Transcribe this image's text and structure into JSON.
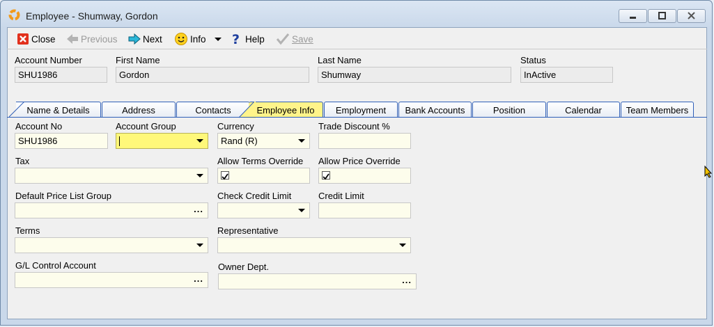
{
  "window": {
    "title": "Employee - Shumway, Gordon",
    "controls": [
      "minimize",
      "restore",
      "close"
    ]
  },
  "toolbar": {
    "close": "Close",
    "previous": "Previous",
    "next": "Next",
    "info": "Info",
    "help": "Help",
    "save": "Save"
  },
  "header": {
    "account_number_label": "Account Number",
    "account_number": "SHU1986",
    "first_name_label": "First Name",
    "first_name": "Gordon",
    "last_name_label": "Last Name",
    "last_name": "Shumway",
    "status_label": "Status",
    "status": "InActive"
  },
  "tabs": [
    {
      "label": "Name & Details",
      "active": false
    },
    {
      "label": "Address",
      "active": false
    },
    {
      "label": "Contacts",
      "active": false
    },
    {
      "label": "Employee Info",
      "active": true
    },
    {
      "label": "Employment",
      "active": false
    },
    {
      "label": "Bank Accounts",
      "active": false
    },
    {
      "label": "Position",
      "active": false
    },
    {
      "label": "Calendar",
      "active": false
    },
    {
      "label": "Team Members",
      "active": false
    }
  ],
  "form": {
    "account_no_label": "Account No",
    "account_no": "SHU1986",
    "account_group_label": "Account Group",
    "account_group": "",
    "currency_label": "Currency",
    "currency": "Rand (R)",
    "trade_discount_label": "Trade Discount %",
    "trade_discount": "",
    "tax_label": "Tax",
    "tax": "",
    "allow_terms_override_label": "Allow Terms Override",
    "allow_terms_override": true,
    "allow_price_override_label": "Allow Price Override",
    "allow_price_override": true,
    "default_price_list_group_label": "Default Price List Group",
    "default_price_list_group": "",
    "check_credit_limit_label": "Check Credit Limit",
    "check_credit_limit": "",
    "credit_limit_label": "Credit Limit",
    "credit_limit": "",
    "terms_label": "Terms",
    "terms": "",
    "representative_label": "Representative",
    "representative": "",
    "gl_control_account_label": "G/L Control Account",
    "gl_control_account": "",
    "owner_dept_label": "Owner Dept.",
    "owner_dept": "",
    "lookup_glyph": "..."
  },
  "colors": {
    "active_tab": "#fff48a",
    "focused_field": "#fff87a",
    "input_background": "#fdfdec",
    "tab_border": "#2f5fb8"
  }
}
